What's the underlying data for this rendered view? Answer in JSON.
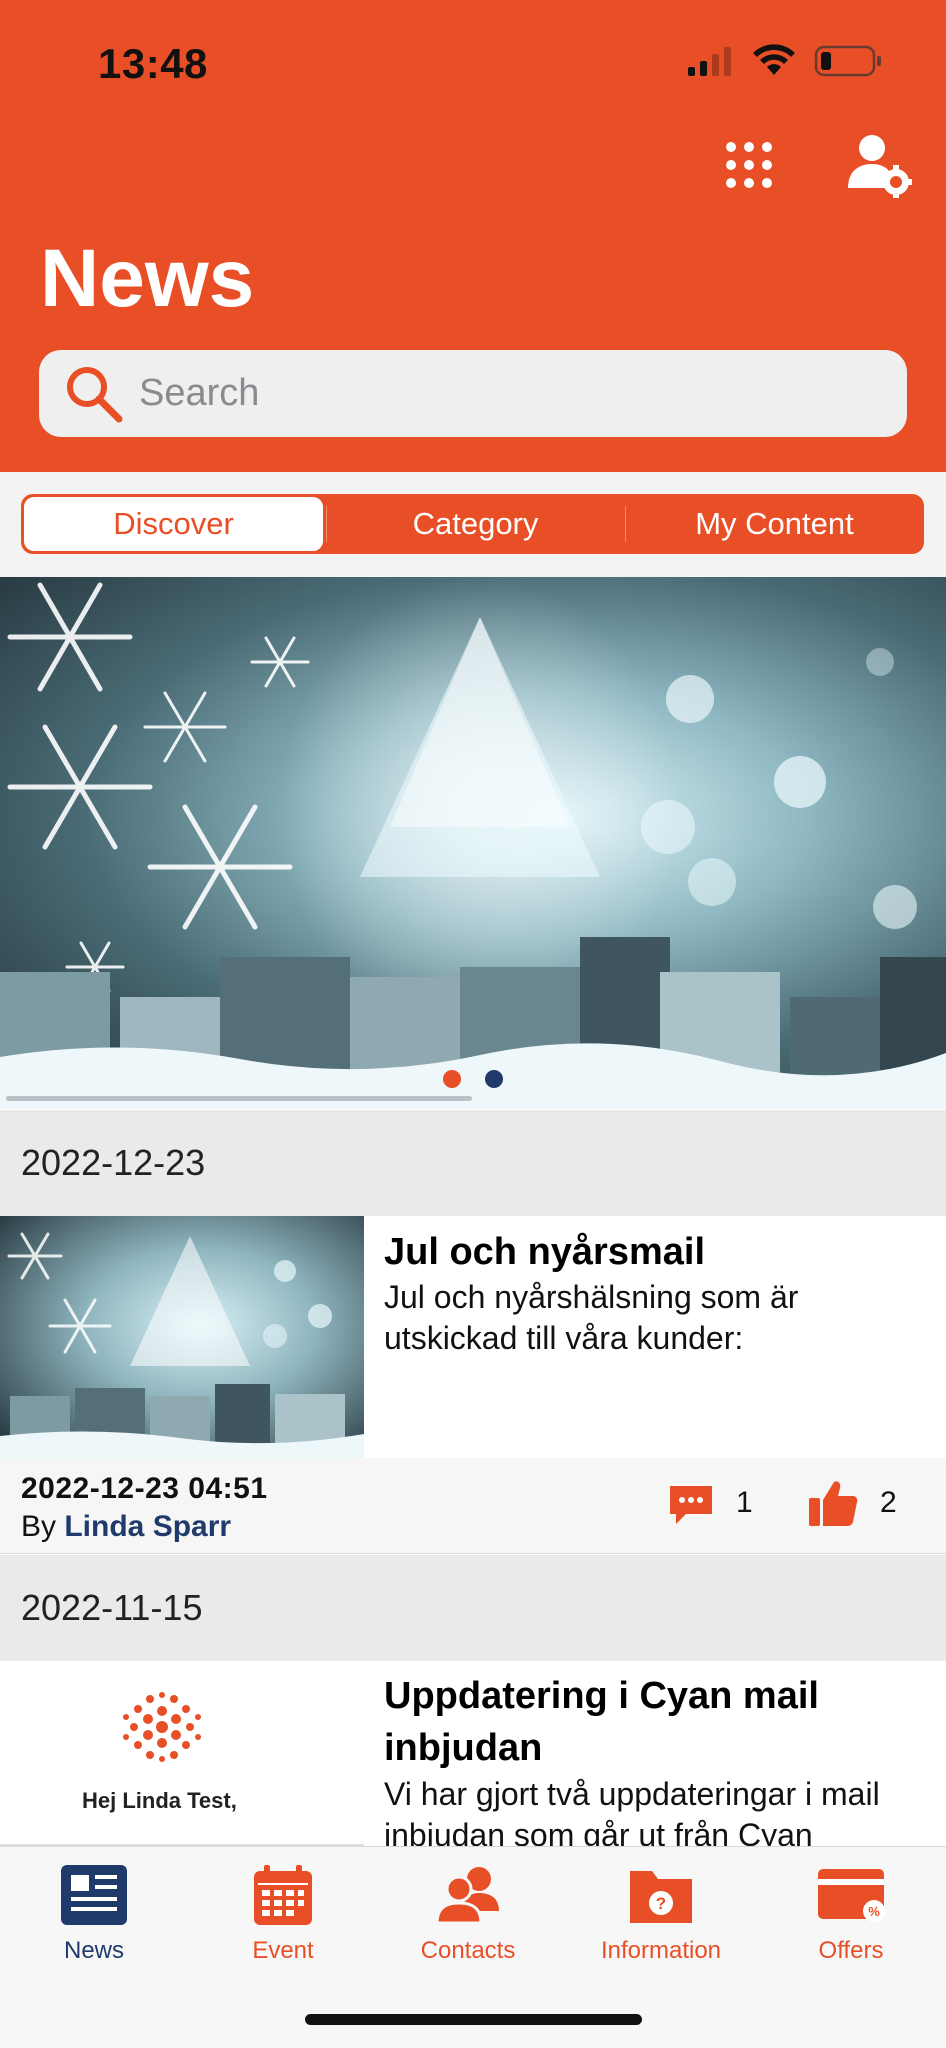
{
  "colors": {
    "accent": "#E84F26",
    "navy": "#1F3A6B",
    "background_gray": "#EAEAEA"
  },
  "status_bar": {
    "time": "13:48",
    "icons": [
      "cellular-signal-icon",
      "wifi-icon",
      "battery-low-icon"
    ]
  },
  "header": {
    "title": "News",
    "right_icons": [
      "apps-grid-icon",
      "user-settings-icon"
    ],
    "search": {
      "placeholder": "Search",
      "icon": "search-icon"
    }
  },
  "segments": {
    "items": [
      {
        "label": "Discover",
        "active": true
      },
      {
        "label": "Category",
        "active": false
      },
      {
        "label": "My Content",
        "active": false
      }
    ]
  },
  "carousel": {
    "pages": 2,
    "current_page": 1
  },
  "feed": [
    {
      "section_date": "2022-12-23",
      "title": "Jul och nyårsmail",
      "description": "Jul och nyårshälsning som är utskickad till våra kunder:",
      "timestamp": "2022-12-23 04:51",
      "by_label": "By",
      "author": "Linda Sparr",
      "comments": "1",
      "likes": "2"
    },
    {
      "section_date": "2022-11-15",
      "title": "Uppdatering i Cyan mail inbjudan",
      "description": "Vi har gjort två uppdateringar i mail inbjudan som går ut från Cyan",
      "thumb_text": "Hej Linda Test,"
    }
  ],
  "tabbar": {
    "items": [
      {
        "label": "News",
        "icon": "newspaper-icon",
        "active": true
      },
      {
        "label": "Event",
        "icon": "calendar-icon",
        "active": false
      },
      {
        "label": "Contacts",
        "icon": "contacts-icon",
        "active": false
      },
      {
        "label": "Information",
        "icon": "folder-question-icon",
        "active": false
      },
      {
        "label": "Offers",
        "icon": "discount-card-icon",
        "active": false
      }
    ]
  }
}
